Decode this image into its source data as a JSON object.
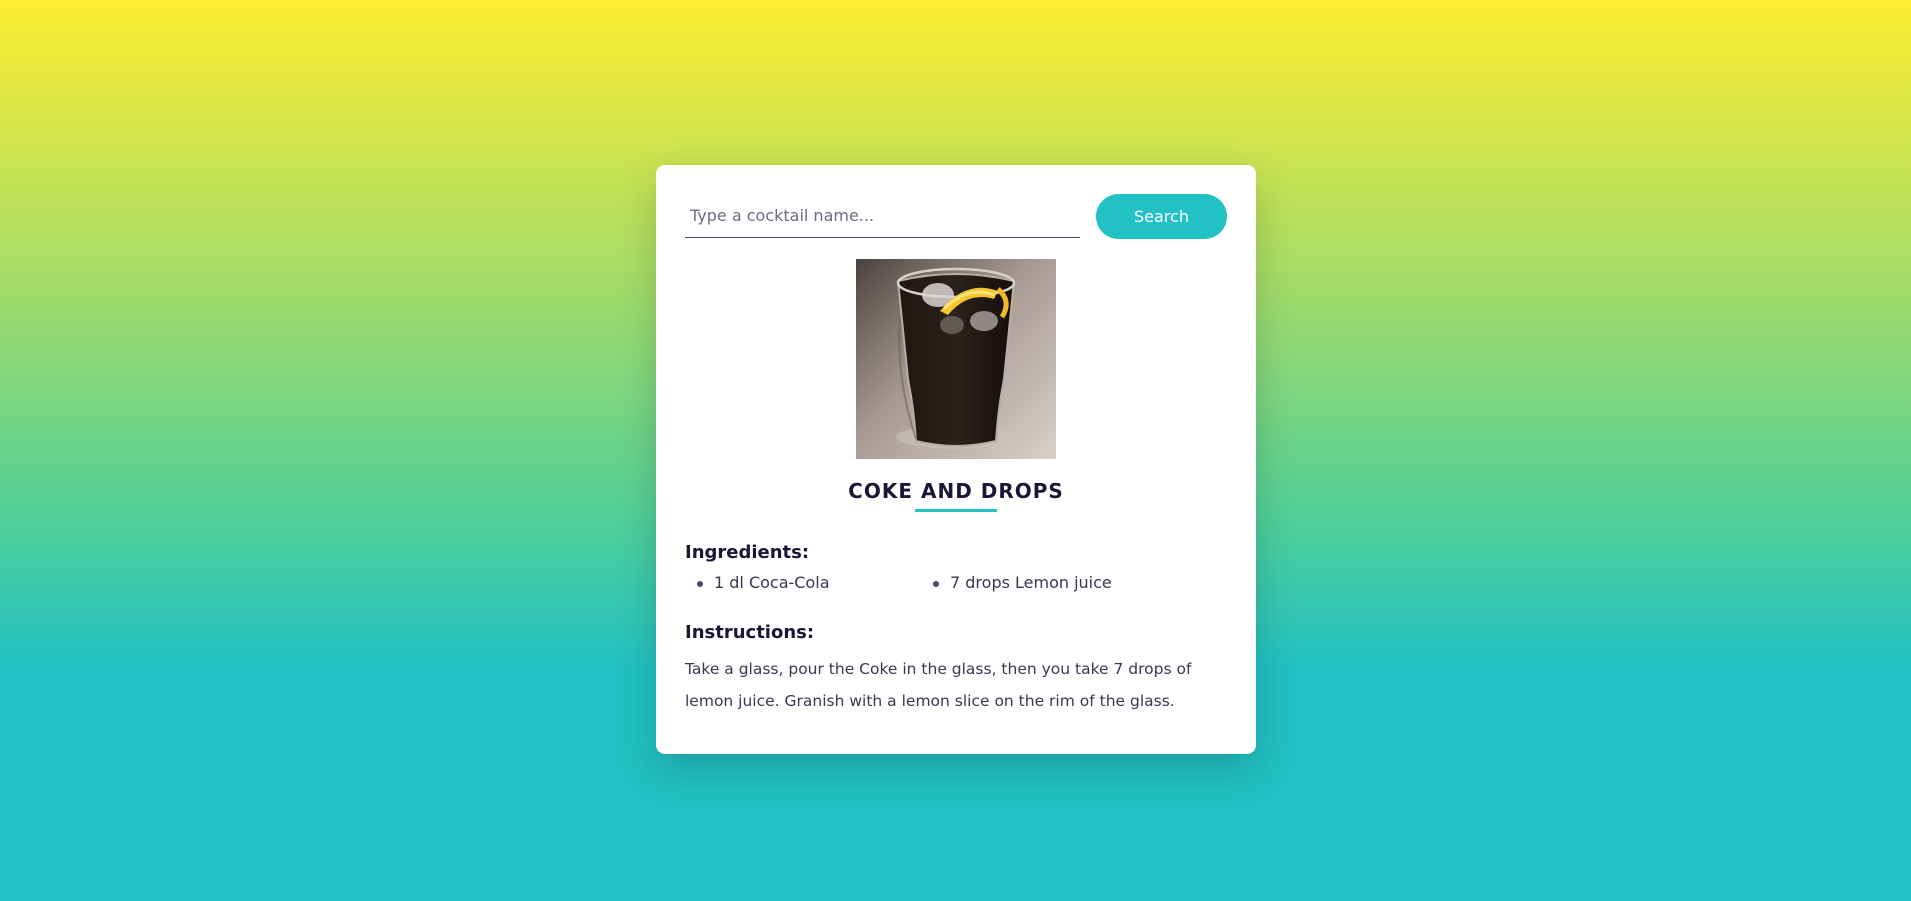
{
  "search": {
    "placeholder": "Type a cocktail name...",
    "value": "",
    "button_label": "Search"
  },
  "drink": {
    "image_alt": "Coke and Drops",
    "name": "COKE AND DROPS",
    "ingredients_heading": "Ingredients:",
    "ingredients": [
      "1 dl Coca-Cola",
      "7 drops Lemon juice"
    ],
    "instructions_heading": "Instructions:",
    "instructions": "Take a glass, pour the Coke in the glass, then you take 7 drops of lemon juice. Granish with a lemon slice on the rim of the glass."
  },
  "colors": {
    "accent": "#22c1c3",
    "gradient_top": "#fded30",
    "text_dark": "#1b1538"
  }
}
